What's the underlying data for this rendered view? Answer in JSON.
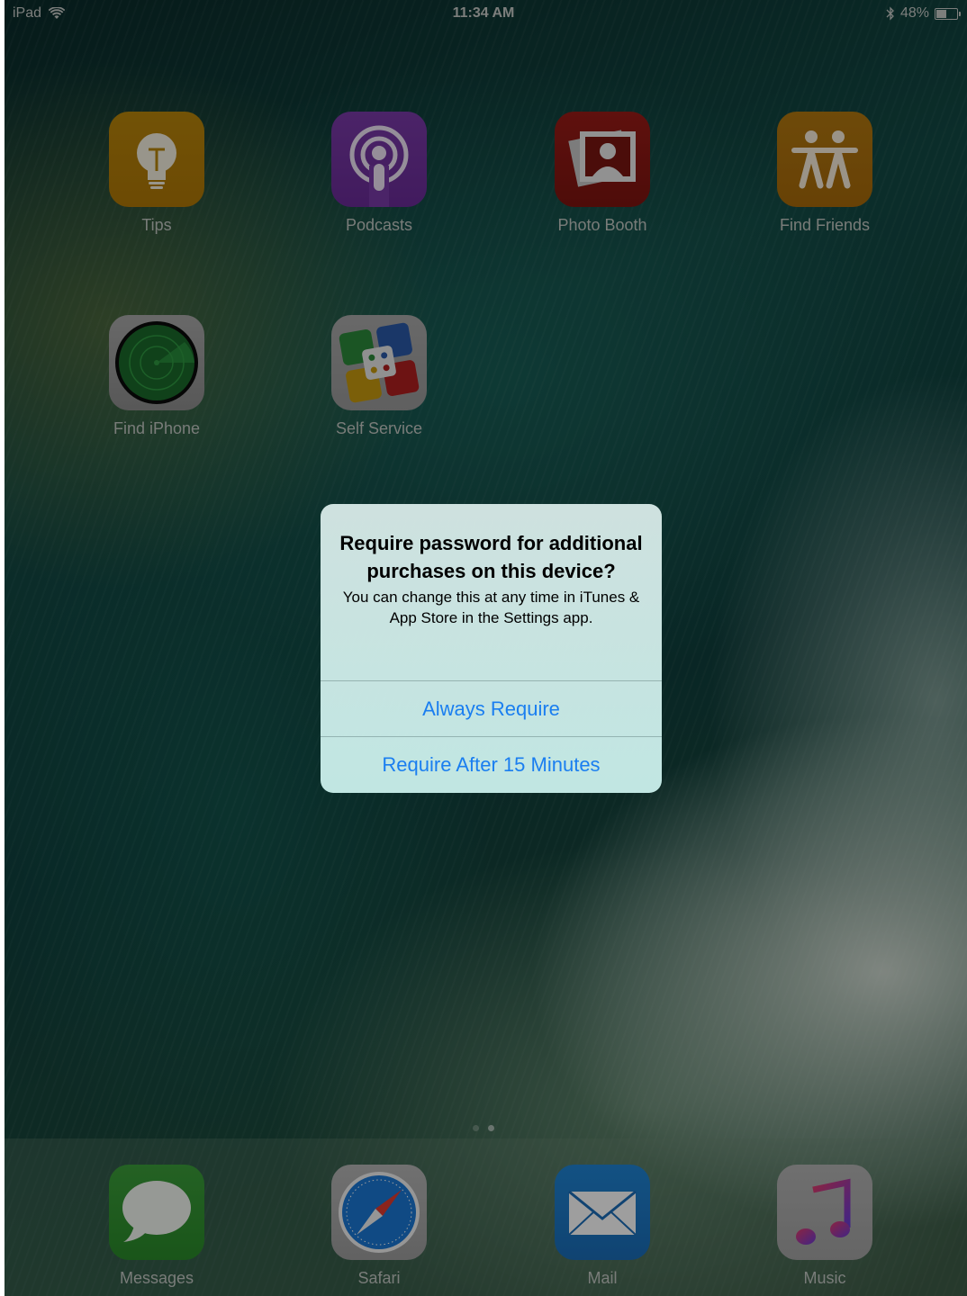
{
  "status_bar": {
    "device": "iPad",
    "time": "11:34 AM",
    "battery": "48%",
    "battery_level": 0.48
  },
  "apps": [
    {
      "label": "Tips",
      "icon": "tips-icon"
    },
    {
      "label": "Podcasts",
      "icon": "podcasts-icon"
    },
    {
      "label": "Photo Booth",
      "icon": "photo-booth-icon"
    },
    {
      "label": "Find Friends",
      "icon": "find-friends-icon"
    },
    {
      "label": "Find iPhone",
      "icon": "find-iphone-icon"
    },
    {
      "label": "Self Service",
      "icon": "self-service-icon"
    }
  ],
  "dock": [
    {
      "label": "Messages",
      "icon": "messages-icon"
    },
    {
      "label": "Safari",
      "icon": "safari-icon"
    },
    {
      "label": "Mail",
      "icon": "mail-icon"
    },
    {
      "label": "Music",
      "icon": "music-icon"
    }
  ],
  "page_indicator": {
    "pages": 2,
    "current": 2
  },
  "alert": {
    "title": "Require password for additional purchases on this device?",
    "message": "You can change this at any time in iTunes & App Store in the Settings app.",
    "buttons": [
      "Always Require",
      "Require After 15 Minutes"
    ]
  },
  "colors": {
    "alert_button_text": "#1a7ef0",
    "label_text": "#c3c8c4"
  }
}
